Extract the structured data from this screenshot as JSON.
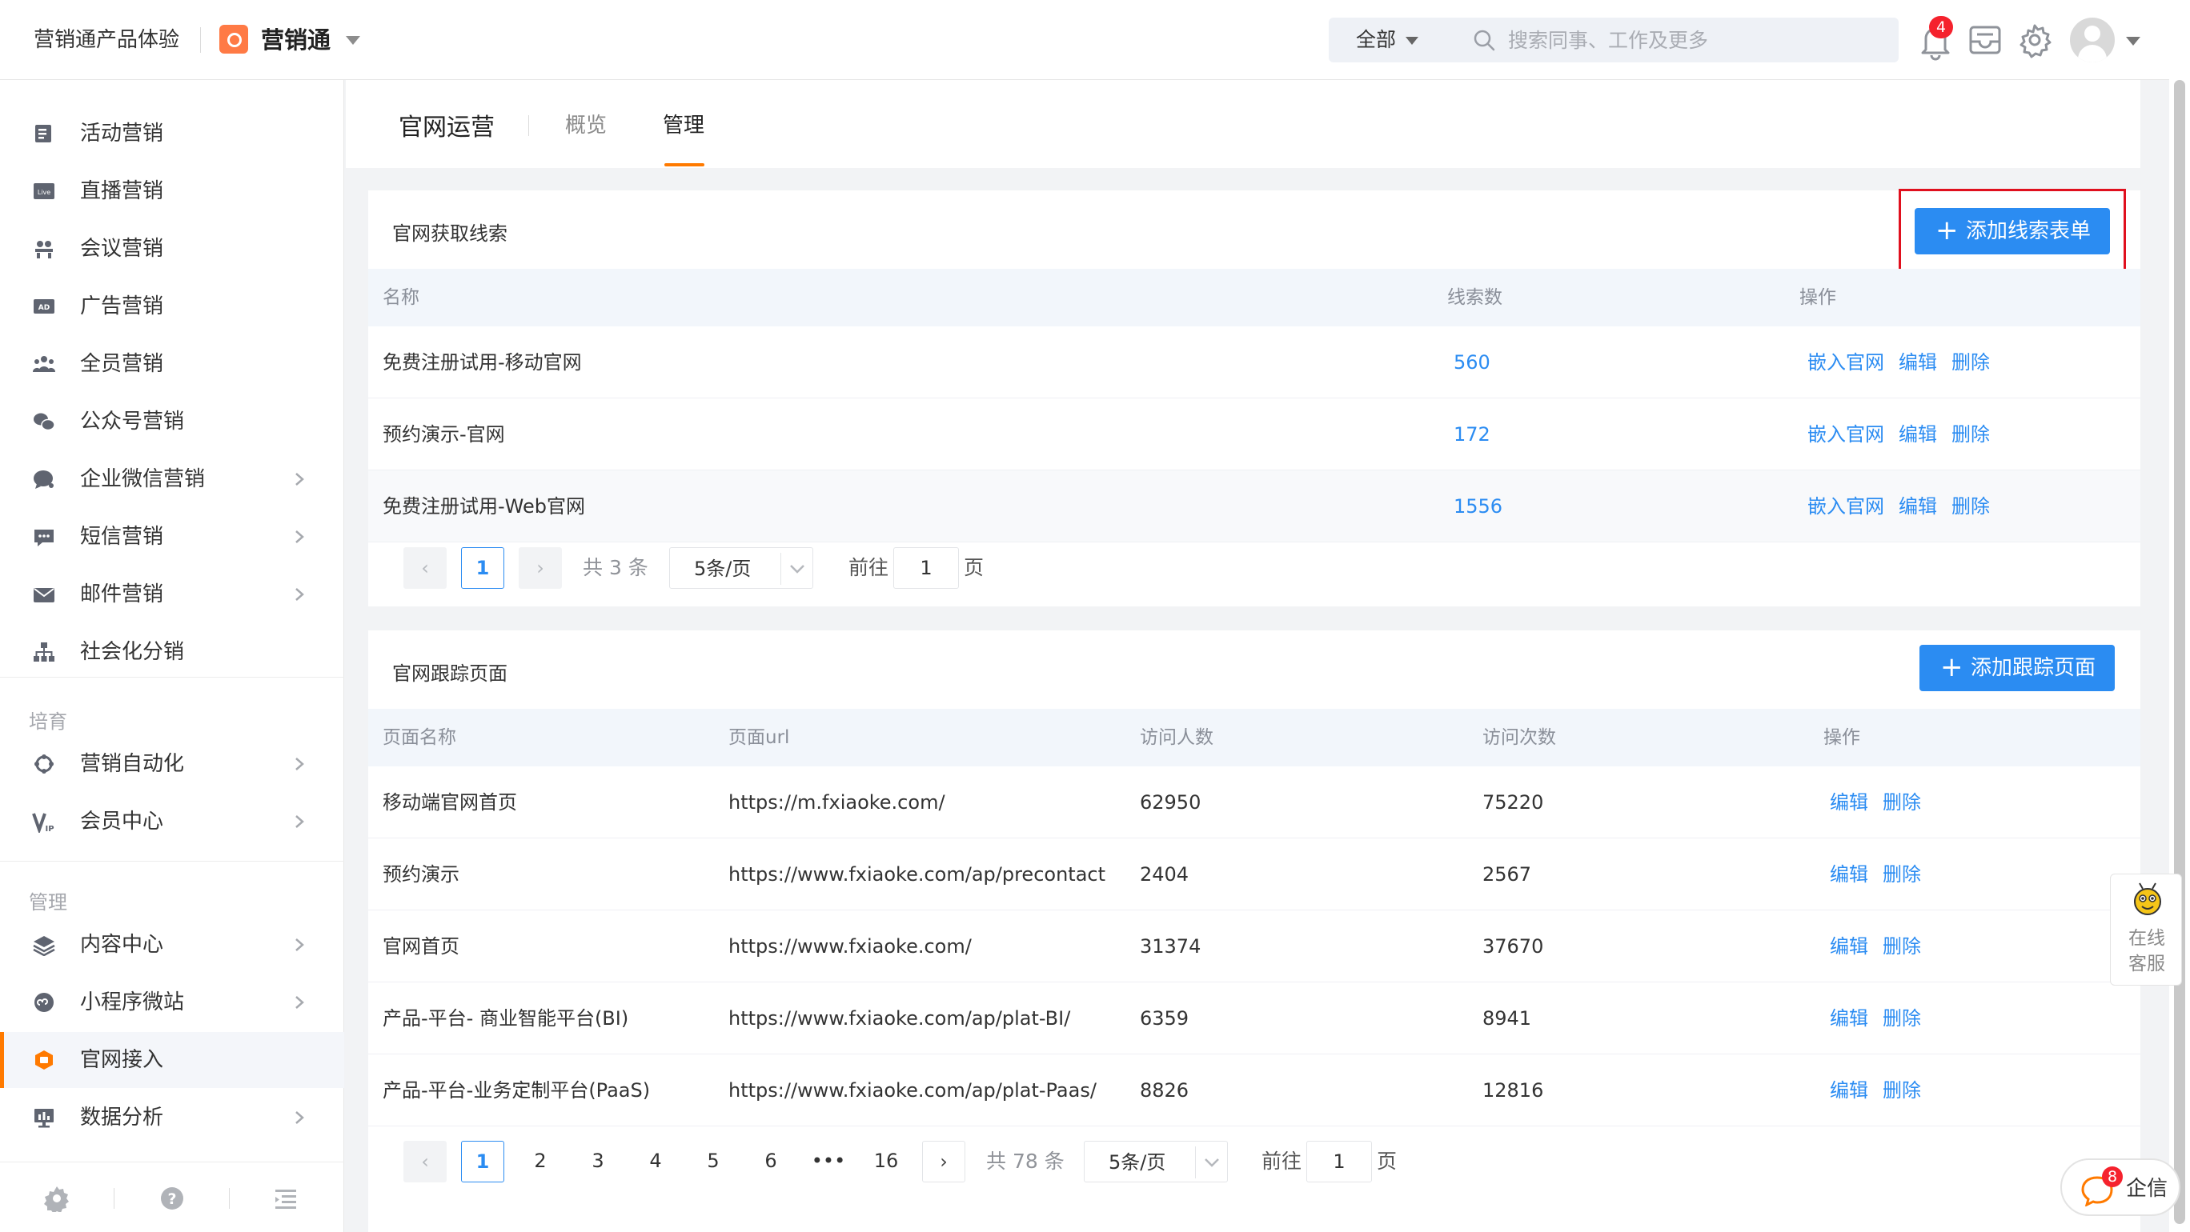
{
  "header": {
    "org_name": "营销通产品体验",
    "app_name": "营销通",
    "search_scope": "全部",
    "search_placeholder": "搜索同事、工作及更多",
    "notification_count": "4"
  },
  "sidebar": {
    "items_top": [
      {
        "label": "活动营销",
        "icon": "list-icon"
      },
      {
        "label": "直播营销",
        "icon": "live-icon"
      },
      {
        "label": "会议营销",
        "icon": "meeting-icon"
      },
      {
        "label": "广告营销",
        "icon": "ad-icon"
      },
      {
        "label": "全员营销",
        "icon": "group-icon"
      },
      {
        "label": "公众号营销",
        "icon": "wechat-icon"
      },
      {
        "label": "企业微信营销",
        "icon": "chat-bubble-icon"
      },
      {
        "label": "短信营销",
        "icon": "sms-icon"
      },
      {
        "label": "邮件营销",
        "icon": "mail-icon"
      },
      {
        "label": "社会化分销",
        "icon": "hierarchy-icon"
      }
    ],
    "section_nurture": "培育",
    "items_nurture": [
      {
        "label": "营销自动化",
        "icon": "automation-icon"
      },
      {
        "label": "会员中心",
        "icon": "vip-icon"
      }
    ],
    "section_manage": "管理",
    "items_manage": [
      {
        "label": "内容中心",
        "icon": "layers-icon"
      },
      {
        "label": "小程序微站",
        "icon": "mini-program-icon"
      },
      {
        "label": "官网接入",
        "icon": "website-icon"
      },
      {
        "label": "数据分析",
        "icon": "analytics-icon"
      }
    ]
  },
  "tabs": {
    "title": "官网运营",
    "items": [
      "概览",
      "管理"
    ]
  },
  "leads_card": {
    "title": "官网获取线索",
    "add_button": "添加线索表单",
    "columns": [
      "名称",
      "线索数",
      "操作"
    ],
    "rows": [
      {
        "name": "免费注册试用-移动官网",
        "count": "560"
      },
      {
        "name": "预约演示-官网",
        "count": "172"
      },
      {
        "name": "免费注册试用-Web官网",
        "count": "1556"
      }
    ],
    "actions": [
      "嵌入官网",
      "编辑",
      "删除"
    ],
    "pager": {
      "current": "1",
      "total": "共 3 条",
      "page_size": "5条/页",
      "goto_label": "前往",
      "goto_value": "1",
      "page_suffix": "页"
    }
  },
  "tracking_card": {
    "title": "官网跟踪页面",
    "add_button": "添加跟踪页面",
    "columns": [
      "页面名称",
      "页面url",
      "访问人数",
      "访问次数",
      "操作"
    ],
    "rows": [
      {
        "name": "移动端官网首页",
        "url": "https://m.fxiaoke.com/",
        "visitors": "62950",
        "visits": "75220"
      },
      {
        "name": "预约演示",
        "url": "https://www.fxiaoke.com/ap/precontact",
        "visitors": "2404",
        "visits": "2567"
      },
      {
        "name": "官网首页",
        "url": "https://www.fxiaoke.com/",
        "visitors": "31374",
        "visits": "37670"
      },
      {
        "name": "产品-平台- 商业智能平台(BI)",
        "url": "https://www.fxiaoke.com/ap/plat-BI/",
        "visitors": "6359",
        "visits": "8941"
      },
      {
        "name": "产品-平台-业务定制平台(PaaS)",
        "url": "https://www.fxiaoke.com/ap/plat-Paas/",
        "visitors": "8826",
        "visits": "12816"
      }
    ],
    "actions": [
      "编辑",
      "删除"
    ],
    "pager": {
      "pages": [
        "1",
        "2",
        "3",
        "4",
        "5",
        "6",
        "•••",
        "16"
      ],
      "total": "共 78 条",
      "page_size": "5条/页",
      "goto_label": "前往",
      "goto_value": "1",
      "page_suffix": "页"
    }
  },
  "float": {
    "service_label": "在线客服",
    "qixin_label": "企信",
    "qixin_badge": "8"
  },
  "colors": {
    "accent": "#ff7a00",
    "primary": "#2b8cf2",
    "highlight": "#e0101e"
  }
}
